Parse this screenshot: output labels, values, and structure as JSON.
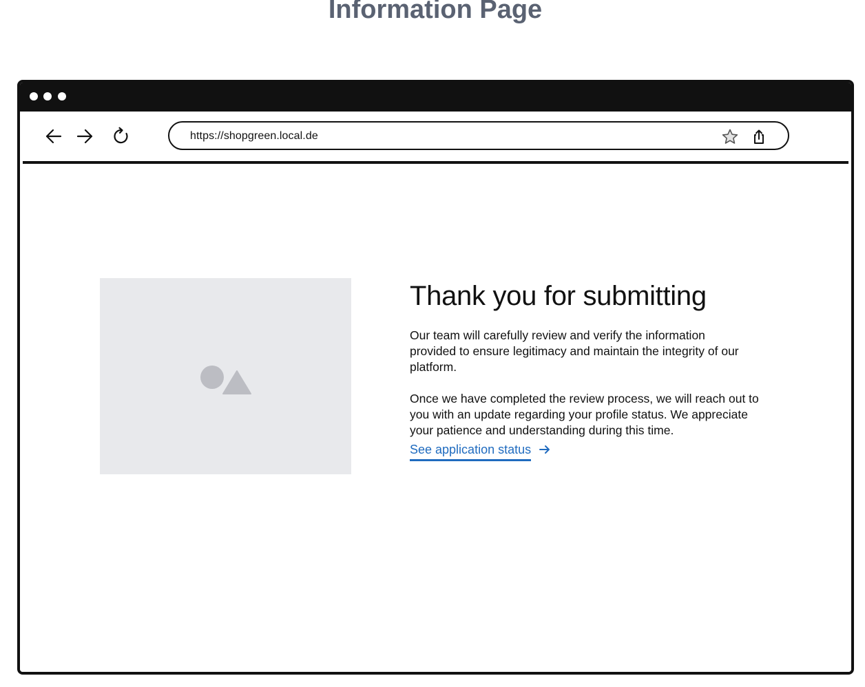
{
  "page": {
    "heading": "Information Page"
  },
  "browser": {
    "address_bar": {
      "url": "https://shopgreen.local.de"
    },
    "icons": {
      "back": "arrow-left-icon",
      "forward": "arrow-right-icon",
      "reload": "reload-icon",
      "bookmark": "star-icon",
      "share": "share-icon"
    }
  },
  "content": {
    "image_placeholder_icon": "image-placeholder-icon",
    "title": "Thank you for submitting",
    "paragraph_1": "Our team will carefully review and verify the information provided to ensure legitimacy and maintain the integrity of our platform.",
    "paragraph_2": "Once we have completed the review process, we will reach out to you with an update regarding your profile status. We appreciate your patience and understanding during this time.",
    "status_link": {
      "label": "See application status",
      "icon": "arrow-right-icon"
    }
  },
  "colors": {
    "heading": "#5a6272",
    "frame": "#111111",
    "link": "#1f6bbf",
    "placeholder_bg": "#e8e9ec",
    "placeholder_shape": "#bcbdc3"
  }
}
